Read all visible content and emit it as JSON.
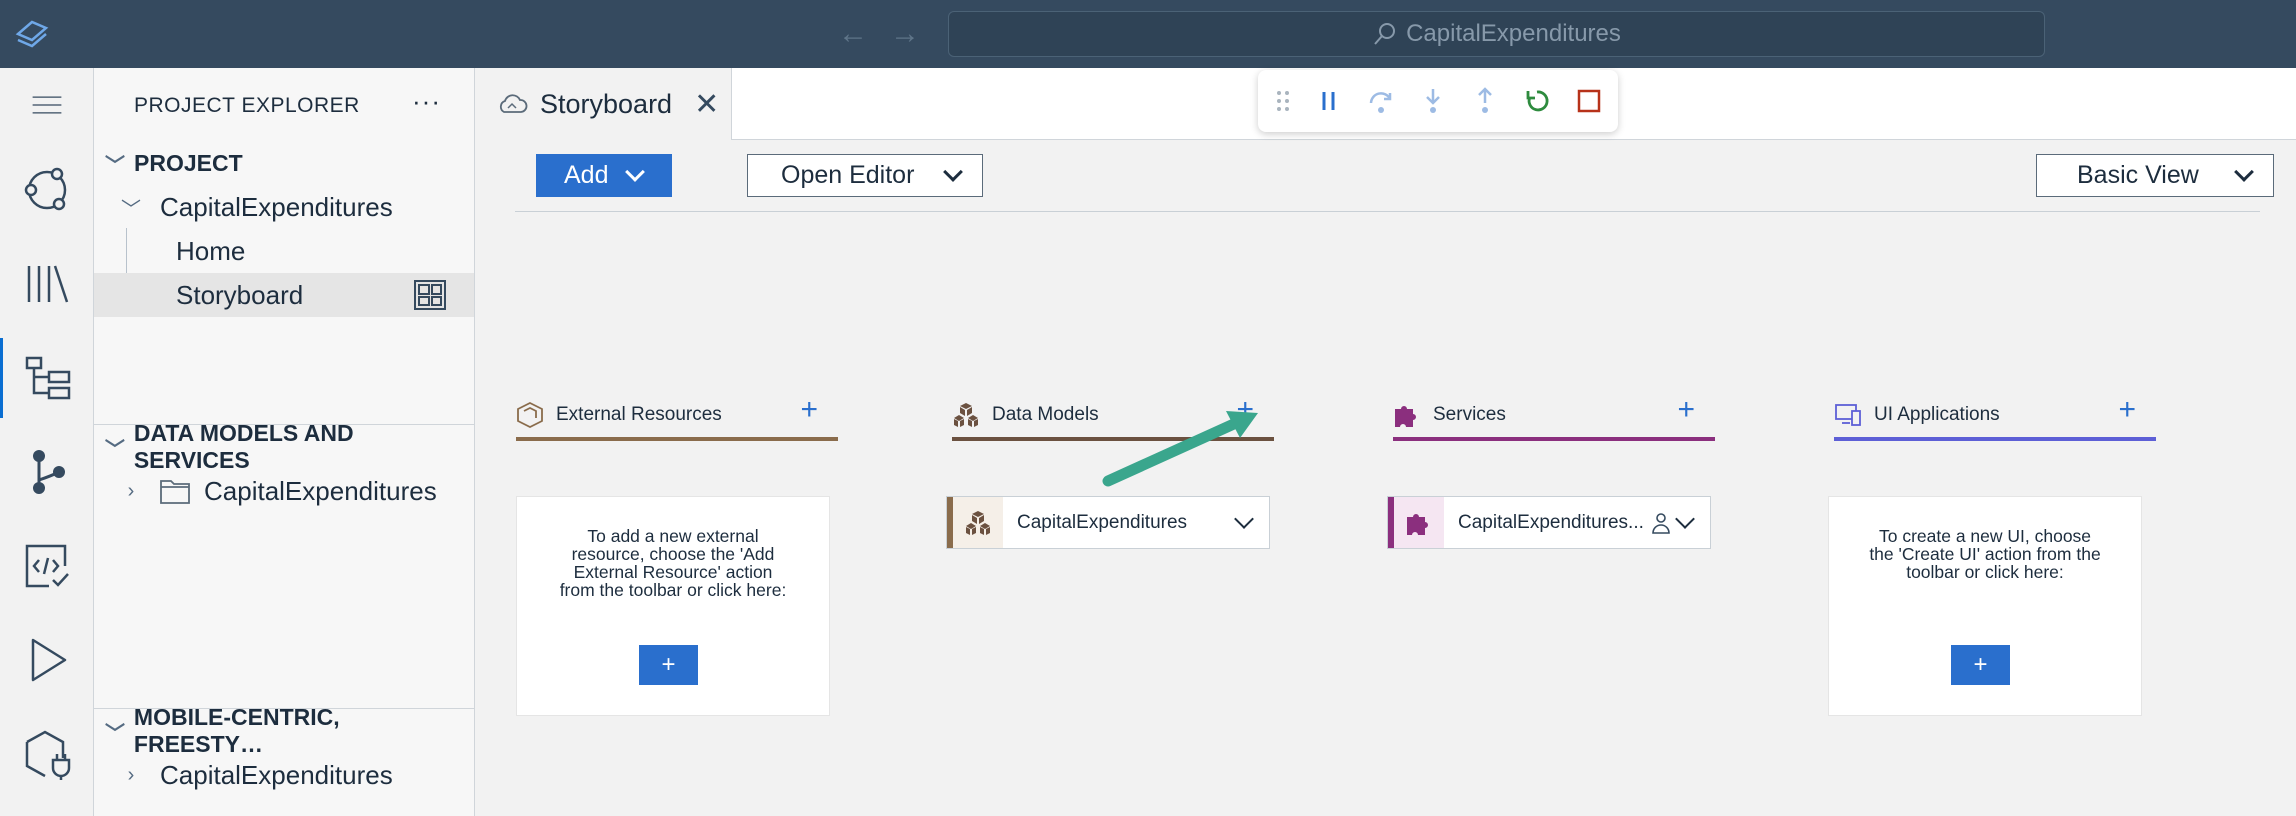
{
  "titlebar": {
    "search_text": "CapitalExpenditures"
  },
  "explorer": {
    "title": "PROJECT EXPLORER",
    "more": "···",
    "sections": {
      "project": "PROJECT",
      "project_root": "CapitalExpenditures",
      "home": "Home",
      "storyboard": "Storyboard",
      "data_models": "DATA MODELS AND SERVICES",
      "data_models_folder": "CapitalExpenditures",
      "mobile": "MOBILE-CENTRIC, FREESTY…",
      "mobile_item": "CapitalExpenditures"
    }
  },
  "tab": {
    "label": "Storyboard",
    "close": "✕"
  },
  "toolbar": {
    "add_label": "Add",
    "open_editor_label": "Open Editor",
    "view_label": "Basic View"
  },
  "columns": {
    "external": {
      "title": "External Resources",
      "plus": "+",
      "empty_text": "To add a new external resource, choose the 'Add External Resource' action from the toolbar or click here:",
      "add": "+"
    },
    "data_models": {
      "title": "Data Models",
      "plus": "+",
      "item": "CapitalExpenditures"
    },
    "services": {
      "title": "Services",
      "plus": "+",
      "item": "CapitalExpenditures..."
    },
    "ui_apps": {
      "title": "UI Applications",
      "plus": "+",
      "empty_text": "To create a new UI, choose the 'Create UI' action from the toolbar or click here:",
      "add": "+"
    }
  },
  "colors": {
    "titlebar": "#354a5f",
    "accent": "#2a6fcd",
    "external": "#8a6c4c",
    "data_models": "#6b5140",
    "services": "#8b2f7e",
    "ui_apps": "#5d5fd6",
    "annotation_arrow": "#3aa68d"
  }
}
